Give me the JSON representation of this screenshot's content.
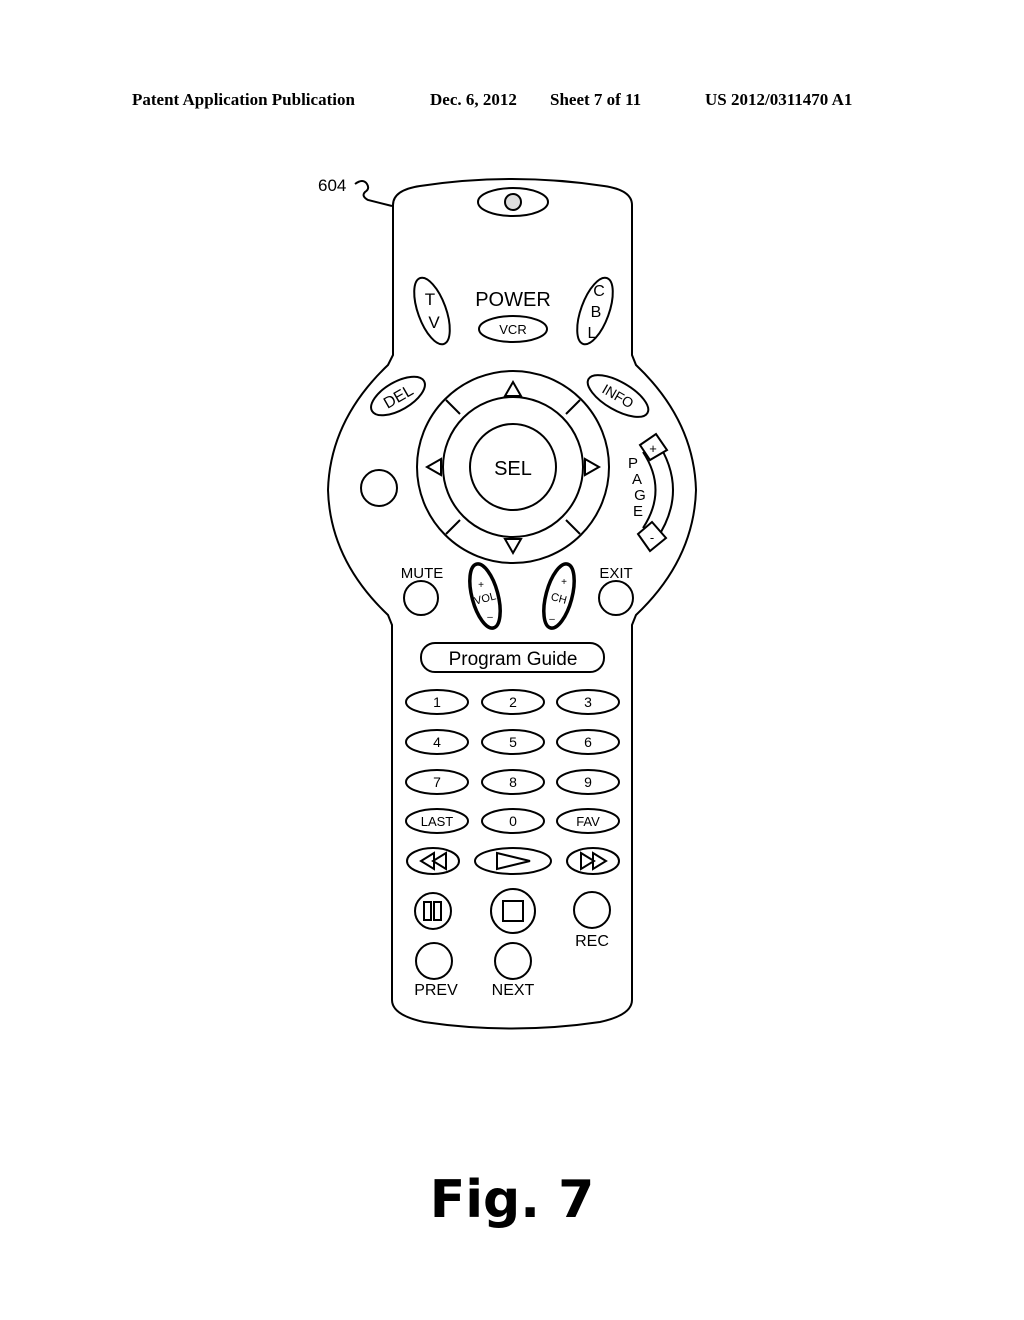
{
  "header": {
    "publication": "Patent Application Publication",
    "date": "Dec. 6, 2012",
    "sheet": "Sheet 7 of 11",
    "number": "US 2012/0311470 A1"
  },
  "reference_label": "604",
  "remote": {
    "power_label": "POWER",
    "tv": "TV",
    "vcr": "VCR",
    "cbl": "CBL",
    "del": "DEL",
    "info": "INFO",
    "sel": "SEL",
    "page": "PAGE",
    "page_plus": "+",
    "page_minus": "-",
    "mute": "MUTE",
    "exit": "EXIT",
    "vol": "VOL",
    "ch": "CH",
    "plus": "+",
    "minus": "–",
    "program_guide": "Program Guide",
    "keypad": [
      "1",
      "2",
      "3",
      "4",
      "5",
      "6",
      "7",
      "8",
      "9",
      "LAST",
      "0",
      "FAV"
    ],
    "rec": "REC",
    "prev": "PREV",
    "next": "NEXT"
  },
  "figure_caption": "Fig. 7"
}
